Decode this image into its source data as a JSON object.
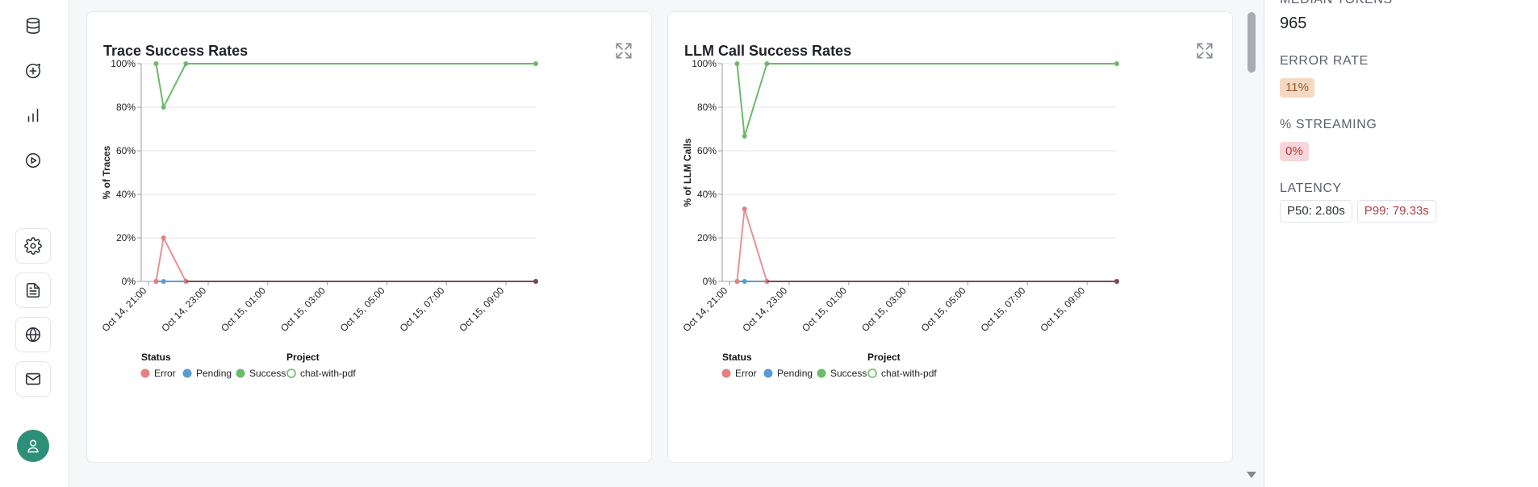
{
  "sidebar": {
    "items": [
      {
        "icon": "database-icon",
        "name": "sidebar-item-data"
      },
      {
        "icon": "message-plus-icon",
        "name": "sidebar-item-chat"
      },
      {
        "icon": "bar-chart-icon",
        "name": "sidebar-item-analytics"
      },
      {
        "icon": "play-circle-icon",
        "name": "sidebar-item-runs"
      }
    ],
    "bottom_items": [
      {
        "icon": "gear-icon",
        "name": "sidebar-item-settings"
      },
      {
        "icon": "document-icon",
        "name": "sidebar-item-docs"
      },
      {
        "icon": "globe-icon",
        "name": "sidebar-item-web"
      },
      {
        "icon": "mail-icon",
        "name": "sidebar-item-mail"
      }
    ],
    "avatar_icon": "user-icon"
  },
  "charts": [
    {
      "title": "Trace Success Rates",
      "ylabel": "% of Traces",
      "chart_data": {
        "type": "line",
        "title": "Trace Success Rates",
        "xlabel": "",
        "ylabel": "% of Traces",
        "ylim": [
          0,
          100
        ],
        "y_ticks": [
          "0%",
          "20%",
          "40%",
          "60%",
          "80%",
          "100%"
        ],
        "x_ticks": [
          "Oct 14, 21:00",
          "Oct 14, 23:00",
          "Oct 15, 01:00",
          "Oct 15, 03:00",
          "Oct 15, 05:00",
          "Oct 15, 07:00",
          "Oct 15, 09:00"
        ],
        "grid": true,
        "legend": {
          "placement": "bottom-left",
          "status_title": "Status",
          "project_title": "Project"
        },
        "series": [
          {
            "name": "Success",
            "color": "#6cba6a",
            "x": [
              "Oct 14, 21:15",
              "Oct 14, 21:30",
              "Oct 14, 22:15",
              "Oct 15, 10:00"
            ],
            "values": [
              100,
              80,
              100,
              100
            ]
          },
          {
            "name": "Error",
            "color": "#e57f80",
            "x": [
              "Oct 14, 21:15",
              "Oct 14, 21:30",
              "Oct 14, 22:15",
              "Oct 15, 10:00"
            ],
            "values": [
              0,
              20,
              0,
              0
            ]
          },
          {
            "name": "Pending",
            "color": "#5b9bd5",
            "x": [
              "Oct 14, 21:15",
              "Oct 14, 21:30",
              "Oct 14, 22:15",
              "Oct 15, 10:00"
            ],
            "values": [
              0,
              0,
              0,
              0
            ]
          }
        ],
        "projects": [
          {
            "name": "chat-with-pdf",
            "color": "#6cba6a"
          }
        ]
      }
    },
    {
      "title": "LLM Call Success Rates",
      "ylabel": "% of LLM Calls",
      "chart_data": {
        "type": "line",
        "title": "LLM Call Success Rates",
        "xlabel": "",
        "ylabel": "% of LLM Calls",
        "ylim": [
          0,
          100
        ],
        "y_ticks": [
          "0%",
          "20%",
          "40%",
          "60%",
          "80%",
          "100%"
        ],
        "x_ticks": [
          "Oct 14, 21:00",
          "Oct 14, 23:00",
          "Oct 15, 01:00",
          "Oct 15, 03:00",
          "Oct 15, 05:00",
          "Oct 15, 07:00",
          "Oct 15, 09:00"
        ],
        "grid": true,
        "legend": {
          "placement": "bottom-left",
          "status_title": "Status",
          "project_title": "Project"
        },
        "series": [
          {
            "name": "Success",
            "color": "#6cba6a",
            "x": [
              "Oct 14, 21:15",
              "Oct 14, 21:30",
              "Oct 14, 22:15",
              "Oct 15, 10:00"
            ],
            "values": [
              100,
              66.7,
              100,
              100
            ]
          },
          {
            "name": "Error",
            "color": "#e57f80",
            "x": [
              "Oct 14, 21:15",
              "Oct 14, 21:30",
              "Oct 14, 22:15",
              "Oct 15, 10:00"
            ],
            "values": [
              0,
              33.3,
              0,
              0
            ]
          },
          {
            "name": "Pending",
            "color": "#5b9bd5",
            "x": [
              "Oct 14, 21:15",
              "Oct 14, 21:30",
              "Oct 14, 22:15",
              "Oct 15, 10:00"
            ],
            "values": [
              0,
              0,
              0,
              0
            ]
          }
        ],
        "projects": [
          {
            "name": "chat-with-pdf",
            "color": "#6cba6a"
          }
        ]
      }
    }
  ],
  "stats": {
    "median_tokens_label": "MEDIAN TOKENS",
    "median_tokens_value": "965",
    "error_rate_label": "ERROR RATE",
    "error_rate_value": "11%",
    "streaming_label": "% STREAMING",
    "streaming_value": "0%",
    "latency_label": "LATENCY",
    "p50": "P50: 2.80s",
    "p99": "P99: 79.33s"
  }
}
